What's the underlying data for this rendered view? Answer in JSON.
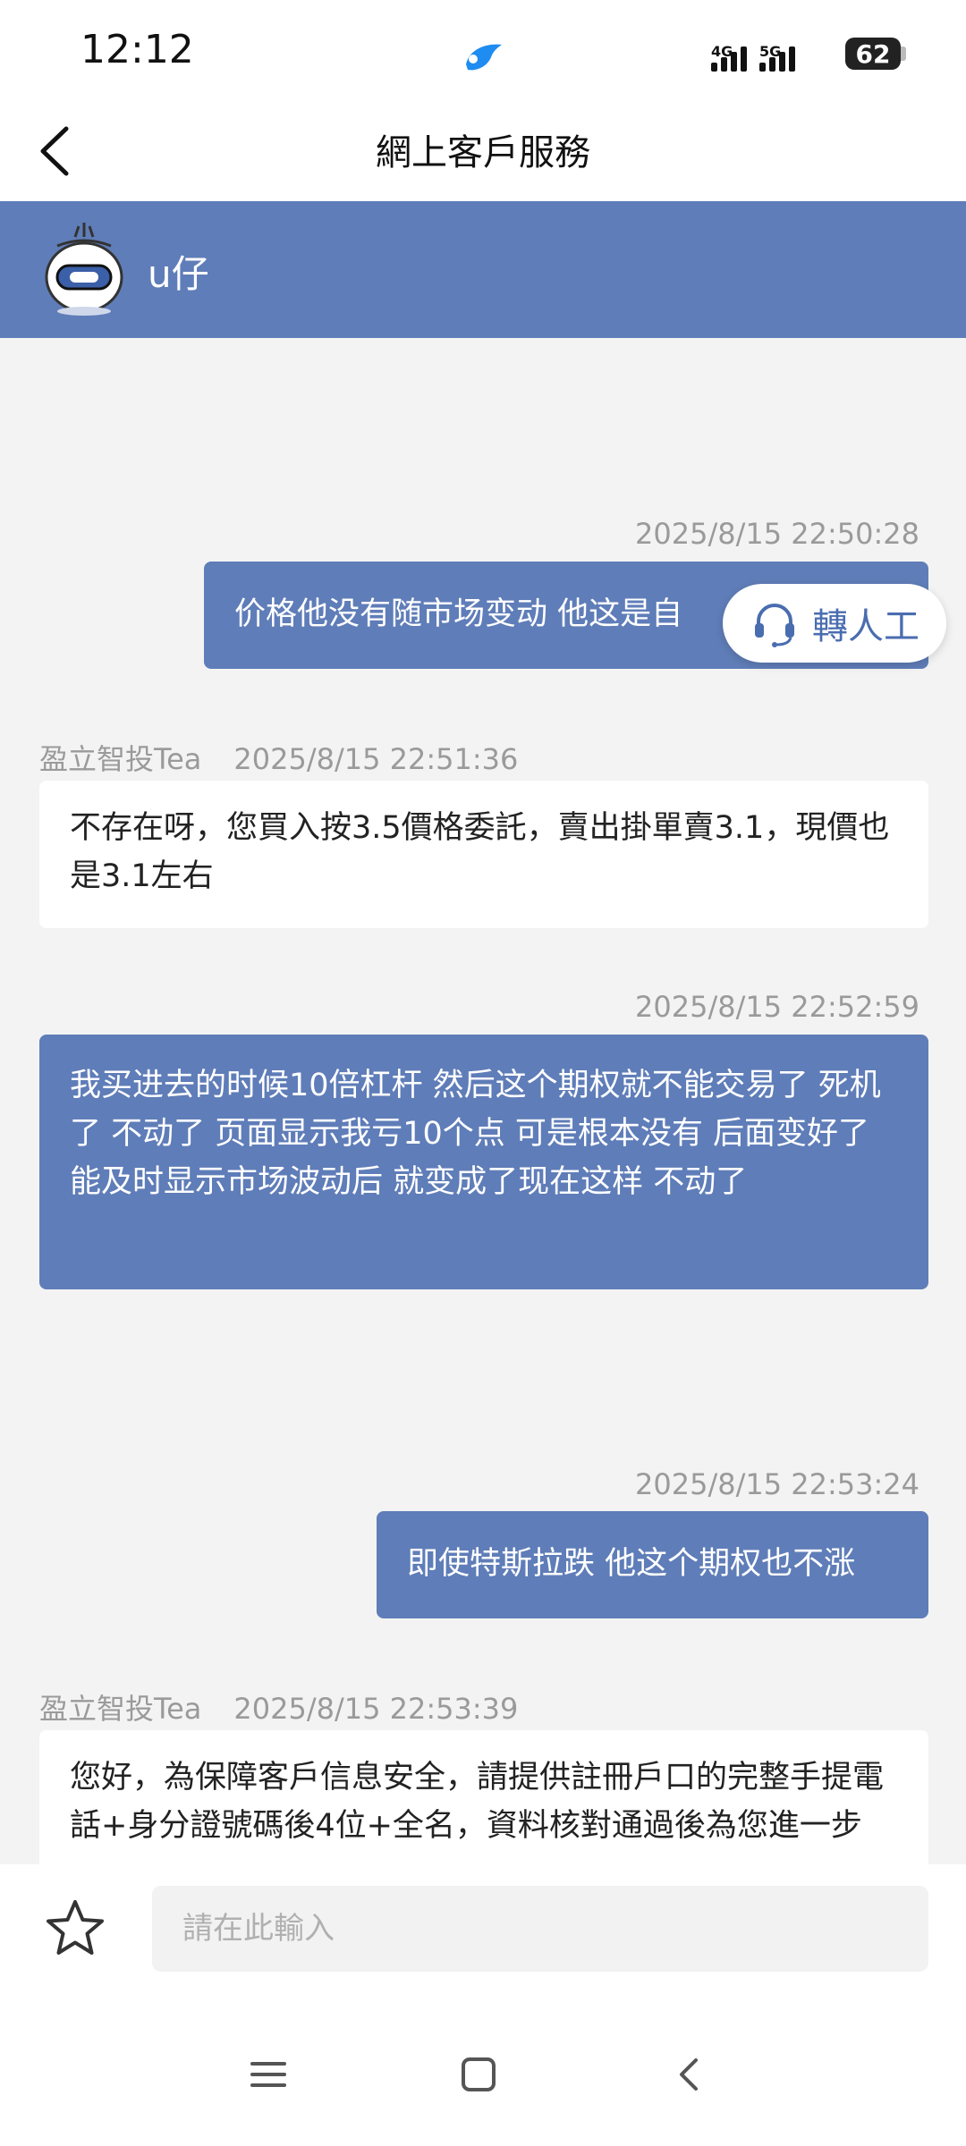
{
  "status": {
    "time": "12:12",
    "net1": "4G",
    "net2": "5G",
    "battery": "62"
  },
  "header": {
    "title": "網上客戶服務"
  },
  "agent": {
    "name": "u仔"
  },
  "messages": [
    {
      "dir": "out",
      "time": "2025/8/15 22:50:28",
      "text": "价格他没有随市场变动 他这是自"
    },
    {
      "dir": "in",
      "sender": "盈立智投Tea",
      "time": "2025/8/15 22:51:36",
      "text": "不存在呀，您買入按3.5價格委託，賣出掛單賣3.1，現價也是3.1左右"
    },
    {
      "dir": "out",
      "time": "2025/8/15 22:52:59",
      "text": "我买进去的时候10倍杠杆 然后这个期权就不能交易了 死机了 不动了 页面显示我亏10个点 可是根本没有 后面变好了能及时显示市场波动后 就变成了现在这样 不动了"
    },
    {
      "dir": "out",
      "time": "2025/8/15 22:53:24",
      "text": "即使特斯拉跌 他这个期权也不涨"
    },
    {
      "dir": "in",
      "sender": "盈立智投Tea",
      "time": "2025/8/15 22:53:39",
      "text": "您好，為保障客戶信息安全，請提供註冊戶口的完整手提電話+身分證號碼後4位+全名，資料核對通過後為您進一步"
    }
  ],
  "transfer": {
    "label": "轉人工",
    "icon": "headset-icon"
  },
  "input": {
    "placeholder": "請在此輸入"
  },
  "icons": {
    "favorite": "star-icon",
    "back": "back-arrow-icon"
  },
  "colors": {
    "accent": "#5f7db8",
    "transfer_text": "#4a6db0"
  }
}
